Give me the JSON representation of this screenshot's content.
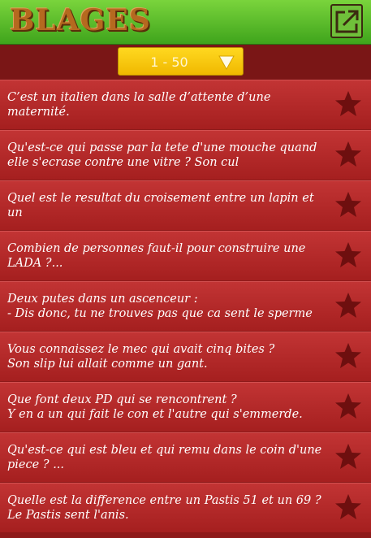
{
  "header": {
    "logo": "BLAGES",
    "share_icon": "share-external-icon"
  },
  "selector": {
    "label": "1 - 50",
    "arrow_icon": "triangle-down-icon"
  },
  "colors": {
    "header_green": "#5cbd2c",
    "row_red": "#b52a2a",
    "star": "#6e0f0f",
    "selector_yellow": "#f7c60e"
  },
  "jokes": [
    {
      "text": "C’est un italien dans la salle d’attente d’une maternité.\n..."
    },
    {
      "text": "Qu'est-ce qui passe par la tete d'une mouche quand\nelle s'ecrase contre une vitre ? Son cul"
    },
    {
      "text": "Quel est le resultat du croisement entre un lapin et un\nelephant ?..."
    },
    {
      "text": "Combien de personnes faut-il pour construire une\nLADA ?..."
    },
    {
      "text": "Deux putes dans un ascenceur :\n- Dis donc, tu ne trouves pas que ca sent le sperme ic..."
    },
    {
      "text": "Vous connaissez le mec qui avait cinq bites ?\nSon slip lui allait comme un gant."
    },
    {
      "text": "Que font deux PD qui se rencontrent ?\nY en a un qui fait le con et l'autre qui s'emmerde."
    },
    {
      "text": "Qu'est-ce qui est bleu et qui remu dans le coin d'une\npiece ? ..."
    },
    {
      "text": "Quelle est la difference entre un Pastis 51 et un 69 ?\nLe Pastis sent l'anis."
    }
  ]
}
